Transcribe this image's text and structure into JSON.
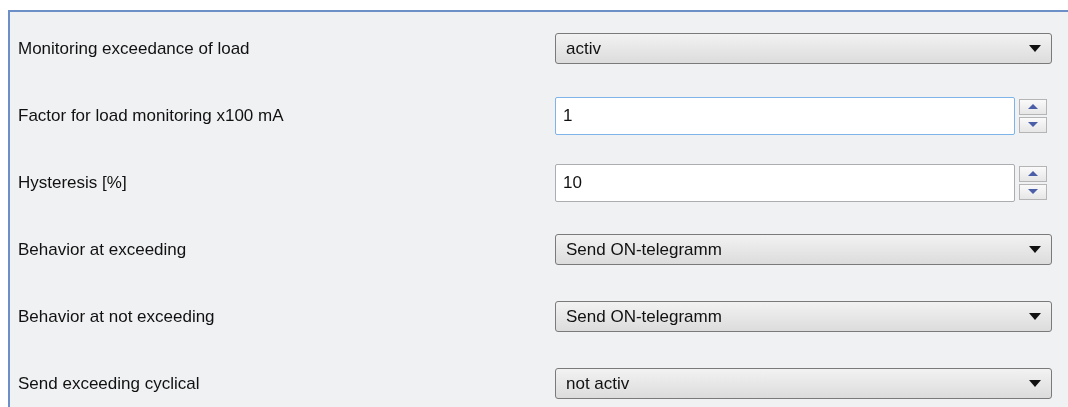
{
  "parameters": [
    {
      "label": "Monitoring exceedance of load",
      "kind": "dropdown",
      "value": "activ"
    },
    {
      "label": "Factor for load monitoring x100 mA",
      "kind": "spinner",
      "value": "1",
      "focused": true
    },
    {
      "label": "Hysteresis [%]",
      "kind": "spinner",
      "value": "10",
      "focused": false
    },
    {
      "label": "Behavior at exceeding",
      "kind": "dropdown",
      "value": "Send ON-telegramm"
    },
    {
      "label": "Behavior at not exceeding",
      "kind": "dropdown",
      "value": "Send ON-telegramm"
    },
    {
      "label": "Send exceeding cyclical",
      "kind": "dropdown",
      "value": "not activ"
    }
  ]
}
